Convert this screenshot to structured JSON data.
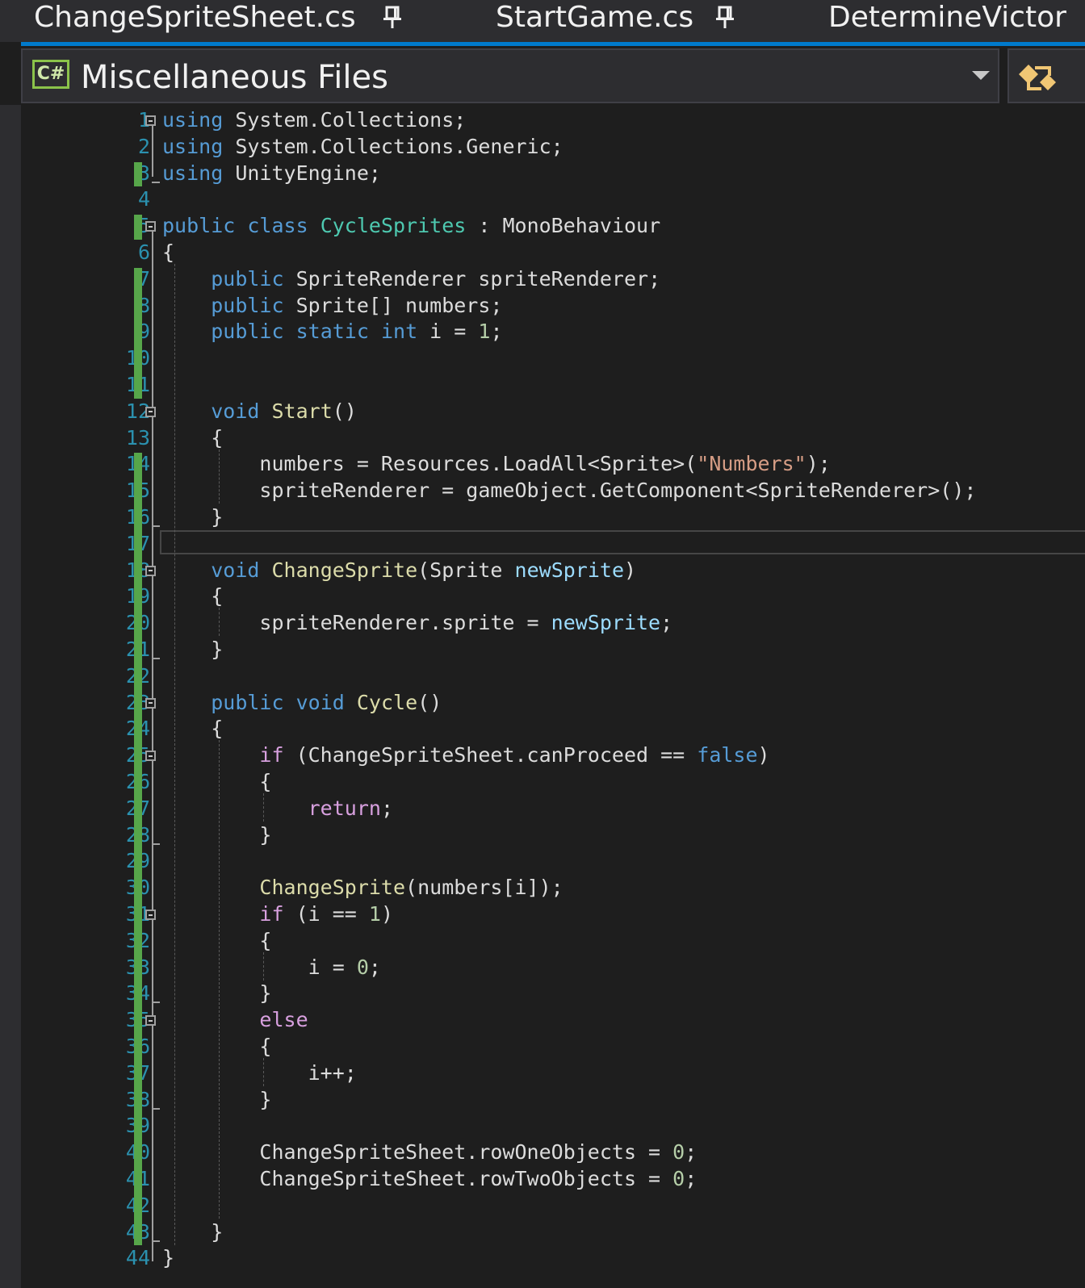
{
  "tabs": [
    {
      "label": "ChangeSpriteSheet.cs",
      "pinned": true
    },
    {
      "label": "StartGame.cs",
      "pinned": true
    },
    {
      "label": "DetermineVictor",
      "pinned": false
    }
  ],
  "tab_icons": {
    "pin": "pin-icon"
  },
  "navbar": {
    "language_badge": "C#",
    "project_name": "Miscellaneous Files",
    "dropdown_icon": "chevron-down-icon",
    "right_icon": "split-navigate-icon"
  },
  "colors": {
    "accent": "#007acc",
    "background": "#1e1e1e",
    "line_number": "#2b91af",
    "change_marker": "#57a64a",
    "keyword": "#569cd6",
    "type": "#4ec9b0",
    "method": "#dcdcaa",
    "string": "#d69d85",
    "number": "#b5cea8",
    "control": "#d8a0df"
  },
  "current_line": 17,
  "code_lines": [
    "using System.Collections;",
    "using System.Collections.Generic;",
    "using UnityEngine;",
    "",
    "public class CycleSprites : MonoBehaviour",
    "{",
    "    public SpriteRenderer spriteRenderer;",
    "    public Sprite[] numbers;",
    "    public static int i = 1;",
    "",
    "",
    "    void Start()",
    "    {",
    "        numbers = Resources.LoadAll<Sprite>(\"Numbers\");",
    "        spriteRenderer = gameObject.GetComponent<SpriteRenderer>();",
    "    }",
    "",
    "    void ChangeSprite(Sprite newSprite)",
    "    {",
    "        spriteRenderer.sprite = newSprite;",
    "    }",
    "",
    "    public void Cycle()",
    "    {",
    "        if (ChangeSpriteSheet.canProceed == false)",
    "        {",
    "            return;",
    "        }",
    "",
    "        ChangeSprite(numbers[i]);",
    "        if (i == 1)",
    "        {",
    "            i = 0;",
    "        }",
    "        else",
    "        {",
    "            i++;",
    "        }",
    "",
    "        ChangeSpriteSheet.rowOneObjects = 0;",
    "        ChangeSpriteSheet.rowTwoObjects = 0;",
    "",
    "    }",
    "}"
  ]
}
